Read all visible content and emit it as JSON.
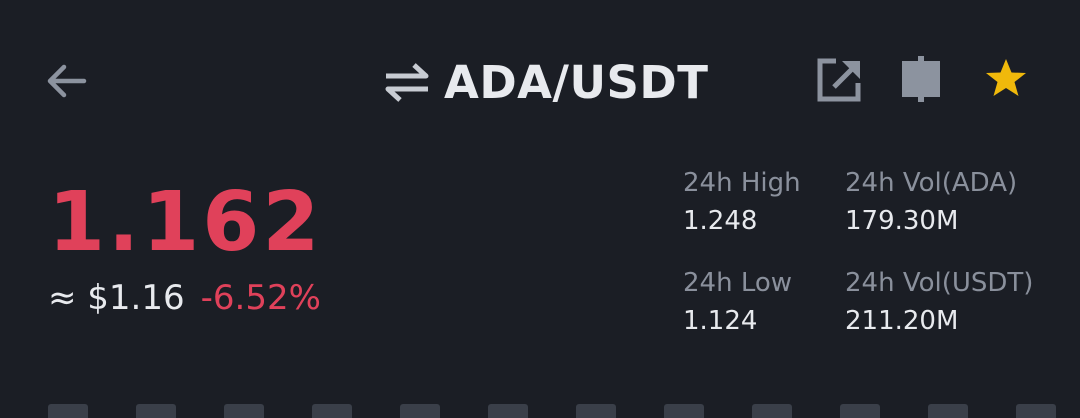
{
  "header": {
    "back_icon": "arrow-left-icon",
    "pair_icon": "swap-arrows-icon",
    "pair": "ADA/USDT",
    "share_icon": "share-external-icon",
    "panel_icon": "panel-split-icon",
    "favorite_icon": "star-icon"
  },
  "ticker": {
    "last_price": "1.162",
    "fiat_value": "≈ $1.16",
    "change_percent": "-6.52%"
  },
  "stats": {
    "high_label": "24h High",
    "high_value": "1.248",
    "low_label": "24h Low",
    "low_value": "1.124",
    "vol_base_label": "24h Vol(ADA)",
    "vol_base_value": "179.30M",
    "vol_quote_label": "24h Vol(USDT)",
    "vol_quote_value": "211.20M"
  },
  "colors": {
    "background": "#1b1e25",
    "price_down": "#e0415a",
    "text_primary": "#e8eaee",
    "text_secondary": "#8a909c",
    "icon_gray": "#8c939f",
    "star": "#f0b90b"
  }
}
